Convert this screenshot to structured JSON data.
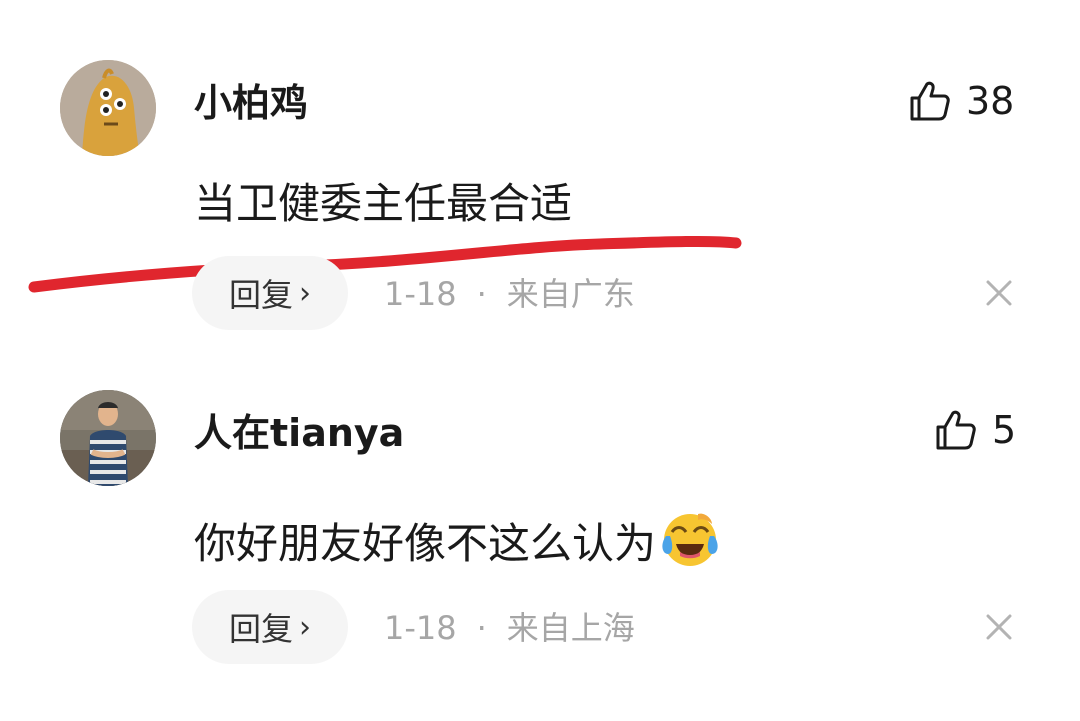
{
  "comments": [
    {
      "username": "小柏鸡",
      "like_count": "38",
      "content": "当卫健委主任最合适",
      "reply_label": "回复",
      "date": "1-18",
      "separator": "·",
      "location": "来自广东",
      "avatar_icon": "cartoon-character-avatar",
      "annotation_color": "#e0262e"
    },
    {
      "username": "人在tianya",
      "like_count": "5",
      "content": "你好朋友好像不这么认为",
      "emoji_icon": "laughing-crying-emoji",
      "reply_label": "回复",
      "date": "1-18",
      "separator": "·",
      "location": "来自上海",
      "avatar_icon": "person-photo-avatar"
    }
  ]
}
